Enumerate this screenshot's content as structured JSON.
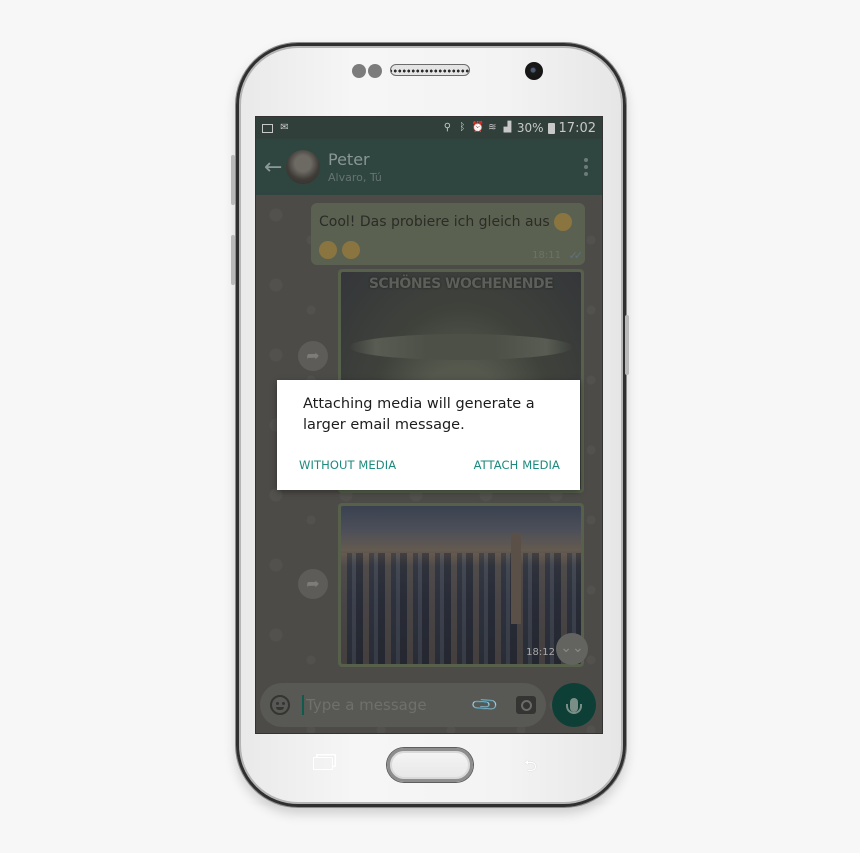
{
  "statusbar": {
    "left_icons": [
      "image-icon",
      "mail-icon"
    ],
    "right_icons": [
      "location-icon",
      "bluetooth-icon",
      "alarm-icon",
      "wifi-icon",
      "signal-icon"
    ],
    "battery_text": "30%",
    "time": "17:02"
  },
  "appbar": {
    "back_glyph": "←",
    "contact_name": "Peter",
    "contact_subtitle": "Alvaro, Tú"
  },
  "messages": [
    {
      "type": "text",
      "text": "Cool! Das probiere ich gleich aus",
      "time": "18:11",
      "status": "read"
    },
    {
      "type": "image",
      "caption_overlay": "SCHÖNES WOCHENENDE",
      "description": "Yoda meme"
    },
    {
      "type": "image",
      "time": "18:12",
      "description": "City skyline"
    }
  ],
  "glyphs": {
    "forward": "➦",
    "scroll_down": "⌄⌄",
    "ticks": "✓✓",
    "clip": "📎",
    "back_key": "⮌"
  },
  "input": {
    "placeholder": "Type a message"
  },
  "dialog": {
    "message": "Attaching media will generate a larger email message.",
    "buttons": {
      "without_media": "WITHOUT MEDIA",
      "attach_media": "ATTACH MEDIA"
    }
  },
  "colors": {
    "accent": "#1c8a7e",
    "appbar": "#2f4540",
    "mic_button": "#0d3f36"
  }
}
